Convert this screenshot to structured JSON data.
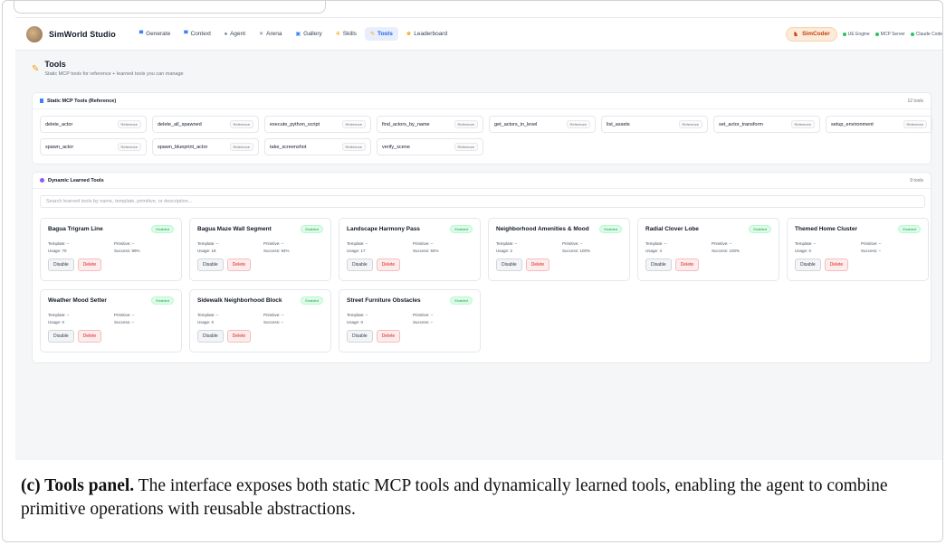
{
  "nav": {
    "brand": "SimWorld Studio",
    "items": [
      {
        "icon": "▀",
        "label": "Generate",
        "color": "#3b82f6"
      },
      {
        "icon": "▀",
        "label": "Context",
        "color": "#3b82f6"
      },
      {
        "icon": "♠",
        "label": "Agent",
        "color": "#6b7280"
      },
      {
        "icon": "✕",
        "label": "Arena",
        "color": "#6b7280"
      },
      {
        "icon": "▣",
        "label": "Gallery",
        "color": "#3b82f6"
      },
      {
        "icon": "✲",
        "label": "Skills",
        "color": "#f59e0b"
      },
      {
        "icon": "✎",
        "label": "Tools",
        "color": "#f59e0b",
        "active": true
      },
      {
        "icon": "♚",
        "label": "Leaderboard",
        "color": "#f59e0b"
      }
    ],
    "simcoder": "SimCoder",
    "status": [
      "UE Engine",
      "MCP Server",
      "Claude Code"
    ]
  },
  "page": {
    "title": "Tools",
    "subtitle": "Static MCP tools for reference + learned tools you can manage"
  },
  "static": {
    "title": "Static MCP Tools (Reference)",
    "count": "12 tools",
    "badge": "Reference",
    "tools": [
      "delete_actor",
      "delete_all_spawned",
      "execute_python_script",
      "find_actors_by_name",
      "get_actors_in_level",
      "list_assets",
      "set_actor_transform",
      "setup_environment",
      "spawn_actor",
      "spawn_blueprint_actor",
      "take_screenshot",
      "verify_scene"
    ]
  },
  "dynamic": {
    "title": "Dynamic Learned Tools",
    "count": "9 tools",
    "search_placeholder": "Search learned tools by name, template, primitive, or description...",
    "enabled_label": "Enabled",
    "disable_label": "Disable",
    "delete_label": "Delete",
    "cards": [
      {
        "title": "Bagua Trigram Line",
        "template": "Template: –",
        "primitive": "Primitive: –",
        "usage": "Usage: 70",
        "success": "Success: 99%"
      },
      {
        "title": "Bagua Maze Wall Segment",
        "template": "Template: –",
        "primitive": "Primitive: –",
        "usage": "Usage: 18",
        "success": "Success: 94%"
      },
      {
        "title": "Landscape Harmony Pass",
        "template": "Template: –",
        "primitive": "Primitive: –",
        "usage": "Usage: 17",
        "success": "Success: 94%"
      },
      {
        "title": "Neighborhood Amenities & Mood",
        "template": "Template: –",
        "primitive": "Primitive: –",
        "usage": "Usage: 2",
        "success": "Success: 100%"
      },
      {
        "title": "Radial Clover Lobe",
        "template": "Template: –",
        "primitive": "Primitive: –",
        "usage": "Usage: 4",
        "success": "Success: 100%"
      },
      {
        "title": "Themed Home Cluster",
        "template": "Template: –",
        "primitive": "Primitive: –",
        "usage": "Usage: 0",
        "success": "Success: –"
      },
      {
        "title": "Weather Mood Setter",
        "template": "Template: –",
        "primitive": "Primitive: –",
        "usage": "Usage: 0",
        "success": "Success: –"
      },
      {
        "title": "Sidewalk Neighborhood Block",
        "template": "Template: –",
        "primitive": "Primitive: –",
        "usage": "Usage: 0",
        "success": "Success: –"
      },
      {
        "title": "Street Furniture Obstacles",
        "template": "Template: –",
        "primitive": "Primitive: –",
        "usage": "Usage: 0",
        "success": "Success: –"
      }
    ]
  },
  "caption": {
    "label": "(c) Tools panel.",
    "text": " The interface exposes both static MCP tools and dynamically learned tools, enabling the agent to combine primitive operations with reusable abstractions."
  }
}
